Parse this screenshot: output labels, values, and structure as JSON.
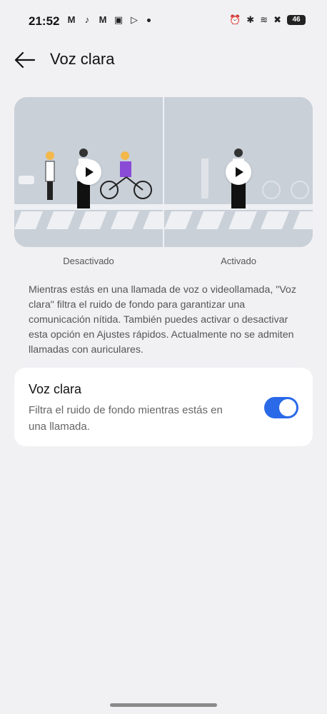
{
  "status_bar": {
    "time": "21:52",
    "battery": "46",
    "notif_icons": [
      "gmail-icon",
      "tiktok-icon",
      "gmail-icon",
      "app-icon",
      "play-store-icon"
    ]
  },
  "header": {
    "title": "Voz clara"
  },
  "preview": {
    "left_caption": "Desactivado",
    "right_caption": "Activado"
  },
  "description": "Mientras estás en una llamada de voz o videollamada, \"Voz clara\" filtra el ruido de fondo para garantizar una comunicación nítida. También puedes activar o desactivar esta opción en Ajustes rápidos. Actualmente no se admiten llamadas con auriculares.",
  "setting": {
    "title": "Voz clara",
    "subtitle": "Filtra el ruido de fondo mientras estás en una llamada.",
    "enabled": true
  },
  "colors": {
    "accent": "#2a6ae8",
    "background": "#f1f1f4"
  }
}
